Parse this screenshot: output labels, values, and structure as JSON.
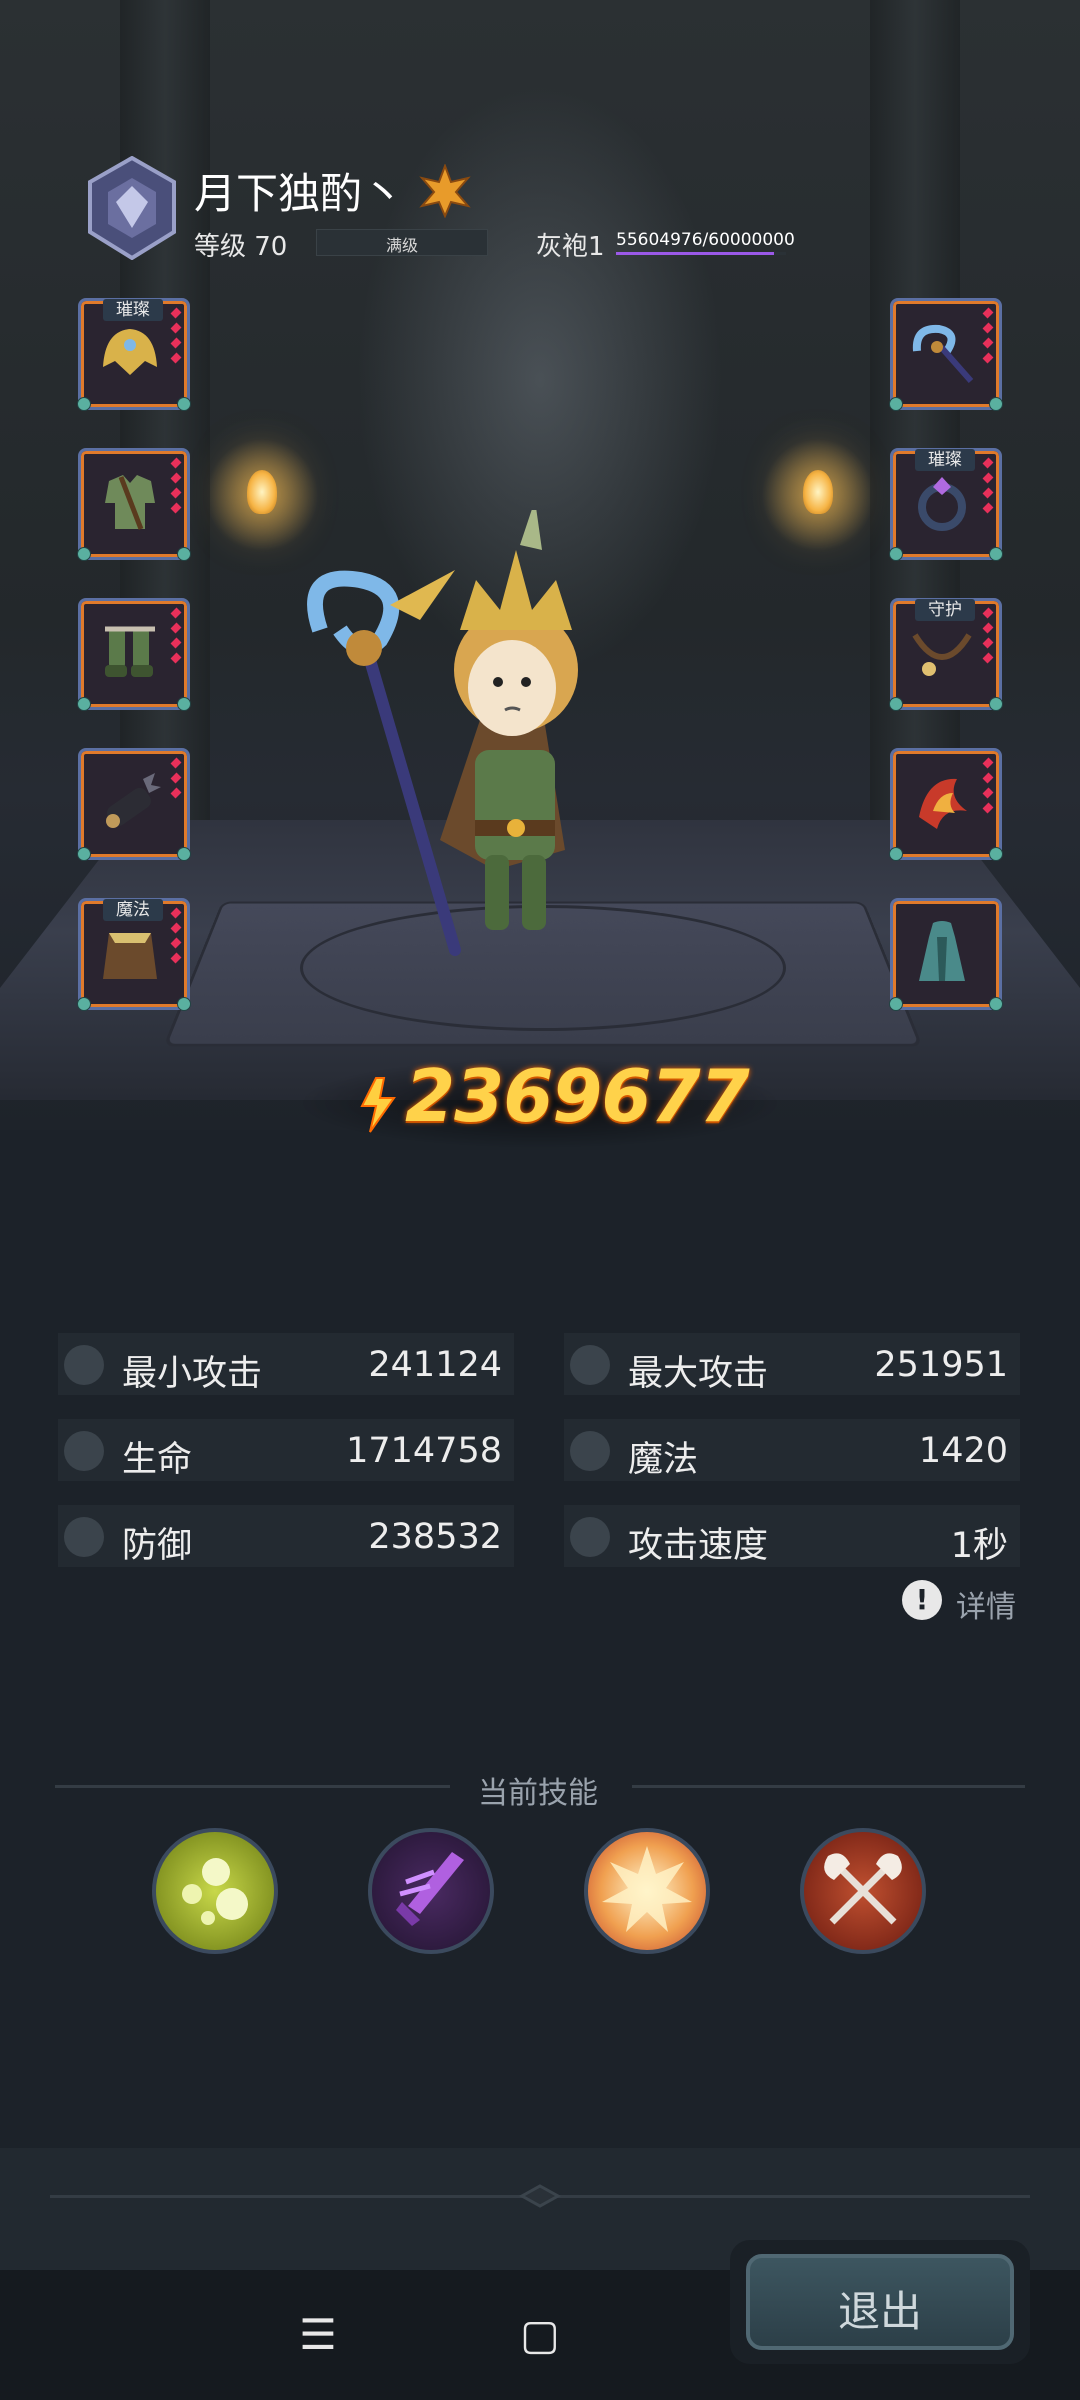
{
  "player": {
    "name": "月下独酌丶",
    "level_label": "等级 70",
    "level_bar_text": "满级",
    "rank": "灰袍1",
    "xp_text": "55604976/60000000",
    "xp_fraction": 0.927
  },
  "equipment": {
    "left": [
      {
        "name": "helmet",
        "tag": "璀璨"
      },
      {
        "name": "armor",
        "tag": ""
      },
      {
        "name": "boots",
        "tag": ""
      },
      {
        "name": "gloves",
        "tag": ""
      },
      {
        "name": "cloak",
        "tag": "魔法"
      }
    ],
    "right": [
      {
        "name": "staff",
        "tag": ""
      },
      {
        "name": "ring",
        "tag": "璀璨"
      },
      {
        "name": "necklace",
        "tag": "守护"
      },
      {
        "name": "emblem",
        "tag": ""
      },
      {
        "name": "robe",
        "tag": ""
      }
    ]
  },
  "power": "2369677",
  "stats": [
    {
      "label": "最小攻击",
      "value": "241124",
      "icon": "sword-icon"
    },
    {
      "label": "最大攻击",
      "value": "251951",
      "icon": "sword-icon"
    },
    {
      "label": "生命",
      "value": "1714758",
      "icon": "heart-icon"
    },
    {
      "label": "魔法",
      "value": "1420",
      "icon": "magic-icon"
    },
    {
      "label": "防御",
      "value": "238532",
      "icon": "shield-icon"
    },
    {
      "label": "攻击速度",
      "value": "1秒",
      "icon": "speed-icon"
    }
  ],
  "details_label": "详情",
  "skills_title": "当前技能",
  "skills": [
    {
      "name": "poison-bubbles-skill",
      "color": "#a3b51d"
    },
    {
      "name": "shadow-blade-skill",
      "color": "#5a2a7a"
    },
    {
      "name": "explosion-skill",
      "color": "#e8703a"
    },
    {
      "name": "crossed-axes-skill",
      "color": "#a63a22"
    }
  ],
  "exit_label": "退出",
  "nav": {
    "menu": "☰",
    "home": "▢",
    "back": "‹"
  }
}
